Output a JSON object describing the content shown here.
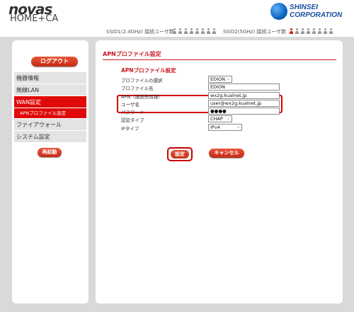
{
  "header": {
    "logo_brand": "novas",
    "logo_model": "HOME+CA",
    "company_line1": "SHINSEI",
    "company_line2": "CORPORATION"
  },
  "status": {
    "ssid1_label": "SSID1(2.4GHz) 接続ユーザ数",
    "ssid1_users_connected": 0,
    "ssid2_label": "SSID2(5GHz) 接続ユーザ数",
    "ssid2_users_connected": 1,
    "users_max": 8
  },
  "sidebar": {
    "logout_label": "ログアウト",
    "items": [
      {
        "label": "機器情報"
      },
      {
        "label": "無線LAN"
      },
      {
        "label": "WAN設定"
      },
      {
        "label": "APNプロファイル設定"
      },
      {
        "label": "ファイアウォール"
      },
      {
        "label": "システム設定"
      }
    ],
    "restart_label": "再起動"
  },
  "main": {
    "title": "APNプロファイル設定",
    "section_title": "APNプロファイル設定",
    "fields": {
      "profile_select": {
        "label": "プロファイルの選択",
        "value": "EDION"
      },
      "profile_name": {
        "label": "プロファイル名",
        "value": "EDION"
      },
      "apn": {
        "label": "APN（接続先情報）",
        "value": "wx2g.kualnet.jp"
      },
      "username": {
        "label": "ユーザ名",
        "value": "user@wx2g.kualnet.jp"
      },
      "password": {
        "label": "パスワード",
        "value": "●●●●"
      },
      "auth_type": {
        "label": "認証タイプ",
        "value": "CHAP"
      },
      "ip_type": {
        "label": "IPタイプ",
        "value": "IPv4"
      }
    },
    "set_label": "設定",
    "cancel_label": "キャンセル"
  },
  "colors": {
    "accent_red": "#e00a0a",
    "highlight_border": "#d40000",
    "brand_blue": "#1a4fa0"
  }
}
